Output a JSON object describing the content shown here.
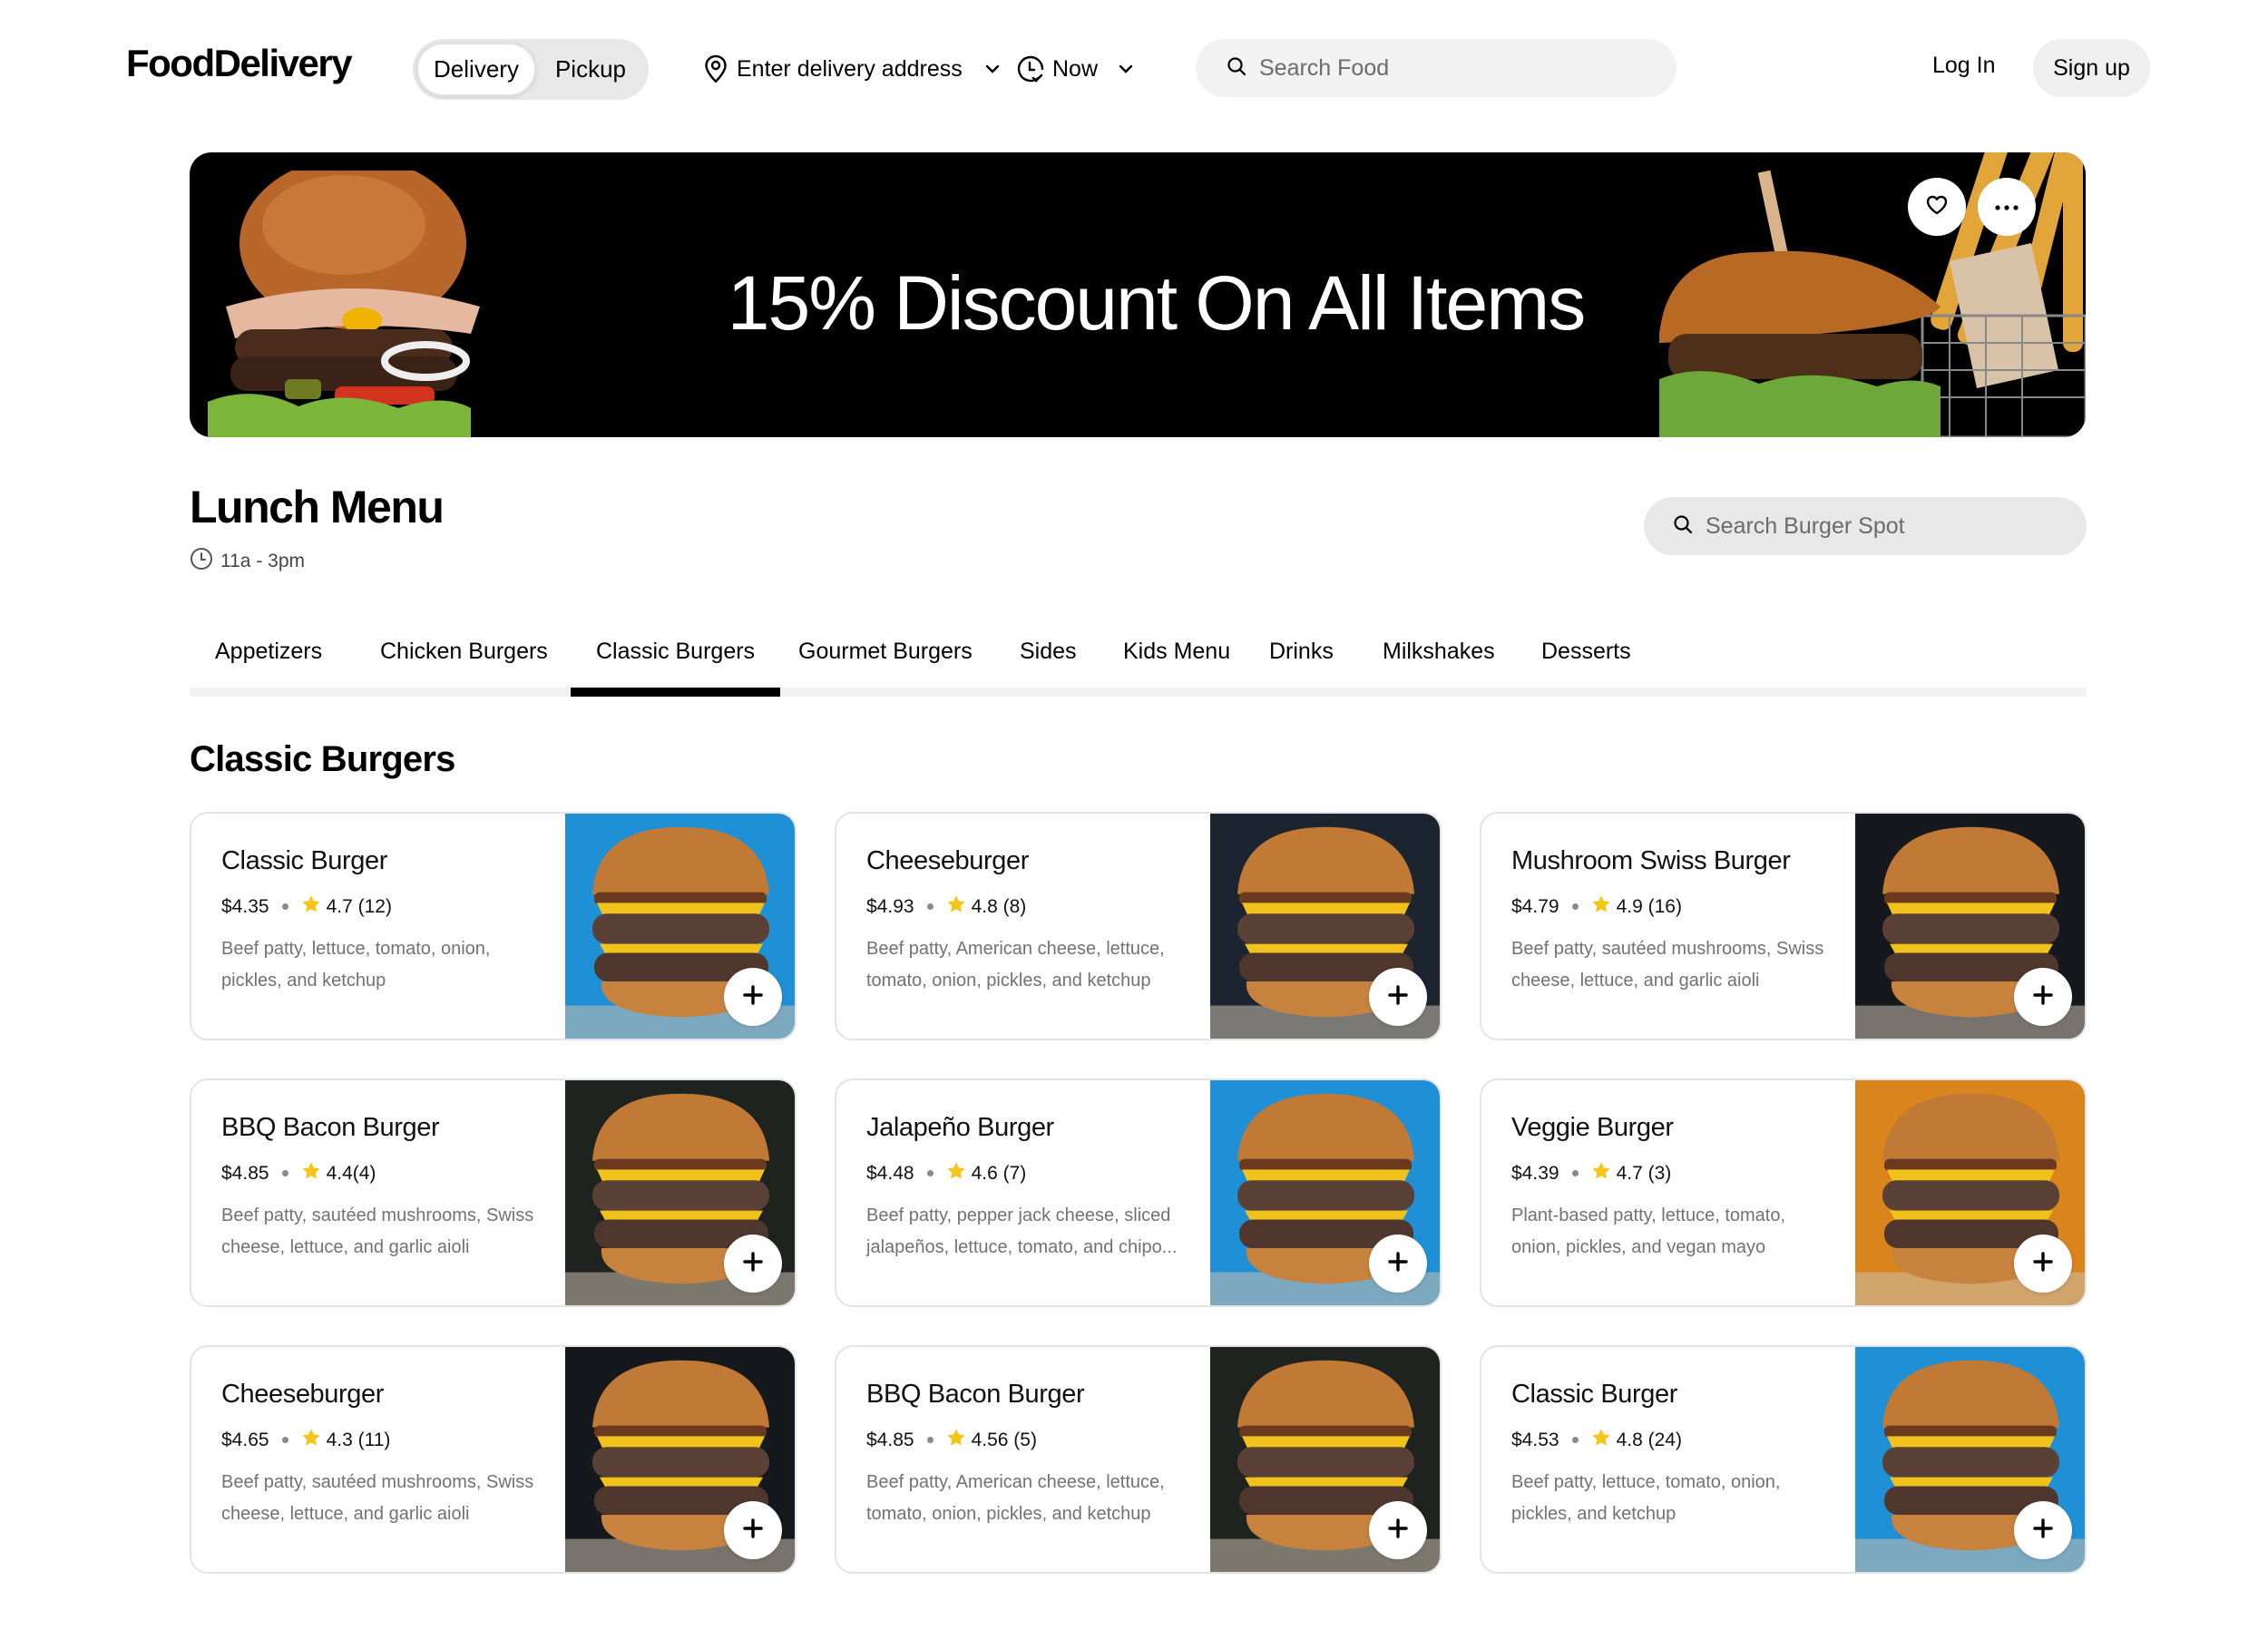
{
  "header": {
    "logo": "FoodDelivery",
    "mode_toggle": {
      "options": [
        "Delivery",
        "Pickup"
      ],
      "selected": "Delivery"
    },
    "address_label": "Enter delivery address",
    "time_label": "Now",
    "search_placeholder": "Search Food",
    "login_label": "Log In",
    "signup_label": "Sign up"
  },
  "banner": {
    "title": "15% Discount On All Items",
    "favorite_icon": "heart-icon",
    "more_icon": "more-horizontal-icon"
  },
  "menu": {
    "title": "Lunch Menu",
    "hours": "11a - 3pm",
    "search_placeholder": "Search Burger Spot"
  },
  "tabs": [
    {
      "label": "Appetizers",
      "active": false
    },
    {
      "label": "Chicken Burgers",
      "active": false
    },
    {
      "label": "Classic Burgers",
      "active": true
    },
    {
      "label": "Gourmet Burgers",
      "active": false
    },
    {
      "label": "Sides",
      "active": false
    },
    {
      "label": "Kids Menu",
      "active": false
    },
    {
      "label": "Drinks",
      "active": false
    },
    {
      "label": "Milkshakes",
      "active": false
    },
    {
      "label": "Desserts",
      "active": false
    }
  ],
  "section_title": "Classic Burgers",
  "items": [
    {
      "name": "Classic Burger",
      "price": "$4.35",
      "rating": "4.7 (12)",
      "description": "Beef patty, lettuce, tomato, onion, pickles, and ketchup",
      "photo_bg": "#1f8fd6"
    },
    {
      "name": "Cheeseburger",
      "price": "$4.93",
      "rating": "4.8 (8)",
      "description": "Beef patty, American cheese, lettuce, tomato, onion, pickles, and ketchup",
      "photo_bg": "#1c2430"
    },
    {
      "name": "Mushroom Swiss Burger",
      "price": "$4.79",
      "rating": "4.9 (16)",
      "description": "Beef patty, sautéed mushrooms, Swiss cheese, lettuce, and garlic aioli",
      "photo_bg": "#15181d"
    },
    {
      "name": "BBQ Bacon Burger",
      "price": "$4.85",
      "rating": "4.4(4)",
      "description": "Beef patty, sautéed mushrooms, Swiss cheese, lettuce, and garlic aioli",
      "photo_bg": "#1e2320"
    },
    {
      "name": "Jalapeño Burger",
      "price": "$4.48",
      "rating": "4.6 (7)",
      "description": "Beef patty, pepper jack cheese, sliced jalapeños, lettuce, tomato, and chipo...",
      "photo_bg": "#1f8fd6"
    },
    {
      "name": "Veggie Burger",
      "price": "$4.39",
      "rating": "4.7 (3)",
      "description": "Plant-based patty, lettuce, tomato, onion, pickles, and vegan mayo",
      "photo_bg": "#d9841c"
    },
    {
      "name": "Cheeseburger",
      "price": "$4.65",
      "rating": "4.3 (11)",
      "description": "Beef patty, sautéed mushrooms, Swiss cheese, lettuce, and garlic aioli",
      "photo_bg": "#15181d"
    },
    {
      "name": "BBQ Bacon Burger",
      "price": "$4.85",
      "rating": "4.56 (5)",
      "description": "Beef patty, American cheese, lettuce, tomato, onion, pickles, and ketchup",
      "photo_bg": "#1e2320"
    },
    {
      "name": "Classic Burger",
      "price": "$4.53",
      "rating": "4.8 (24)",
      "description": "Beef patty, lettuce, tomato, onion, pickles, and ketchup",
      "photo_bg": "#1f8fd6"
    }
  ],
  "colors": {
    "star": "#f5c518",
    "accent": "#000000",
    "muted_text": "#727272"
  }
}
